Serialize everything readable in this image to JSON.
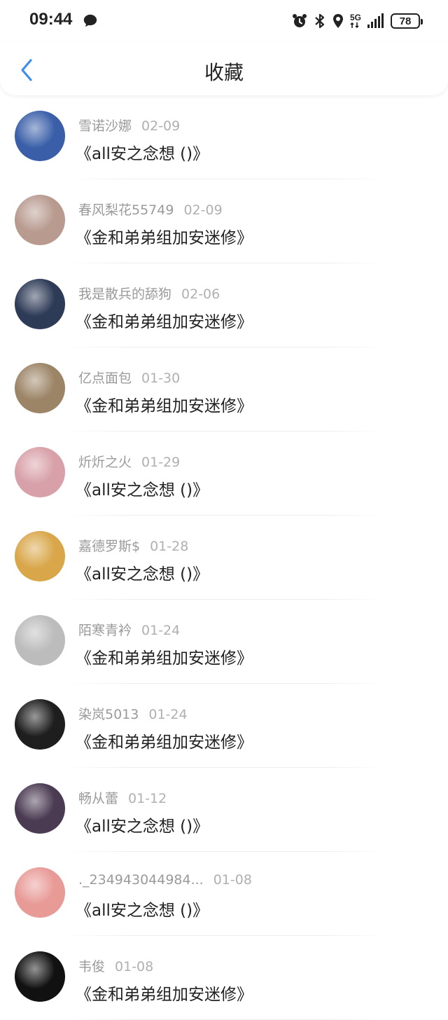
{
  "status": {
    "time": "09:44",
    "network": "5G",
    "battery": "78"
  },
  "header": {
    "title": "收藏"
  },
  "items": [
    {
      "user": "雪诺沙娜",
      "date": "02-09",
      "title": "《all安之念想 ()》",
      "avatar_color": "#3a5fa8"
    },
    {
      "user": "春风梨花55749",
      "date": "02-09",
      "title": "《金和弟弟组加安迷修》",
      "avatar_color": "#b89a8f"
    },
    {
      "user": "我是散兵的舔狗",
      "date": "02-06",
      "title": "《金和弟弟组加安迷修》",
      "avatar_color": "#2e3b57"
    },
    {
      "user": "亿点面包",
      "date": "01-30",
      "title": "《金和弟弟组加安迷修》",
      "avatar_color": "#9c8466"
    },
    {
      "user": "炘炘之火",
      "date": "01-29",
      "title": "《all安之念想 ()》",
      "avatar_color": "#d8a0a8"
    },
    {
      "user": "嘉德罗斯$",
      "date": "01-28",
      "title": "《all安之念想 ()》",
      "avatar_color": "#d9a74a"
    },
    {
      "user": "陌寒青衿",
      "date": "01-24",
      "title": "《金和弟弟组加安迷修》",
      "avatar_color": "#bcbcbc"
    },
    {
      "user": "染岚5013",
      "date": "01-24",
      "title": "《金和弟弟组加安迷修》",
      "avatar_color": "#1e1e1e"
    },
    {
      "user": "畅从蕾",
      "date": "01-12",
      "title": "《all安之念想 ()》",
      "avatar_color": "#4a3a52"
    },
    {
      "user": "._234943044984...",
      "date": "01-08",
      "title": "《all安之念想 ()》",
      "avatar_color": "#e89a96"
    },
    {
      "user": "韦俊",
      "date": "01-08",
      "title": "《金和弟弟组加安迷修》",
      "avatar_color": "#111111"
    }
  ]
}
